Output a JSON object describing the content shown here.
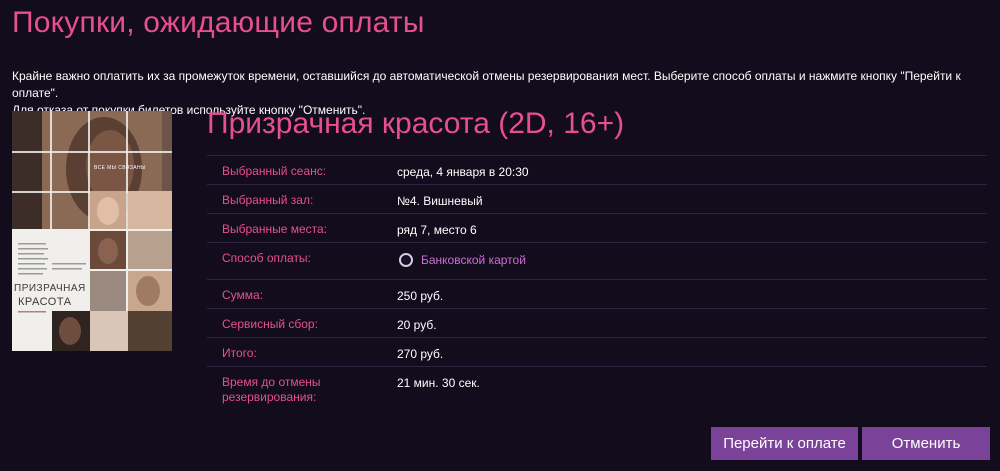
{
  "page": {
    "title": "Покупки, ожидающие оплаты",
    "intro_line1": "Крайне важно оплатить их за промежуток времени, оставшийся до автоматической отмены резервирования мест. Выберите способ оплаты и нажмите кнопку \"Перейти к оплате\".",
    "intro_line2": "Для отказа от покупки билетов используйте кнопку \"Отменить\"."
  },
  "poster": {
    "tagline": "ВСЕ МЫ СВЯЗАНЫ",
    "title_line1": "ПРИЗРАЧНАЯ",
    "title_line2": "КРАСОТА"
  },
  "movie": {
    "title": "Призрачная красота (2D, 16+)"
  },
  "details": {
    "session_label": "Выбранный сеанс:",
    "session_value": "среда, 4 января в 20:30",
    "hall_label": "Выбранный зал:",
    "hall_value": "№4. Вишневый",
    "seats_label": "Выбранные места:",
    "seats_value": "ряд 7, место 6",
    "payment_label": "Способ оплаты:",
    "payment_option": "Банковской картой",
    "sum_label": "Сумма:",
    "sum_value": "250 руб.",
    "fee_label": "Сервисный сбор:",
    "fee_value": "20 руб.",
    "total_label": "Итого:",
    "total_value": "270 руб.",
    "timer_label": "Время до отмены резервирования:",
    "timer_value": "21 мин. 30 сек."
  },
  "buttons": {
    "pay": "Перейти к оплате",
    "cancel": "Отменить"
  },
  "colors": {
    "background": "#120c1c",
    "accent_pink": "#e8508c",
    "button_purple": "#7a4399",
    "radio_label": "#cc6fd6"
  }
}
